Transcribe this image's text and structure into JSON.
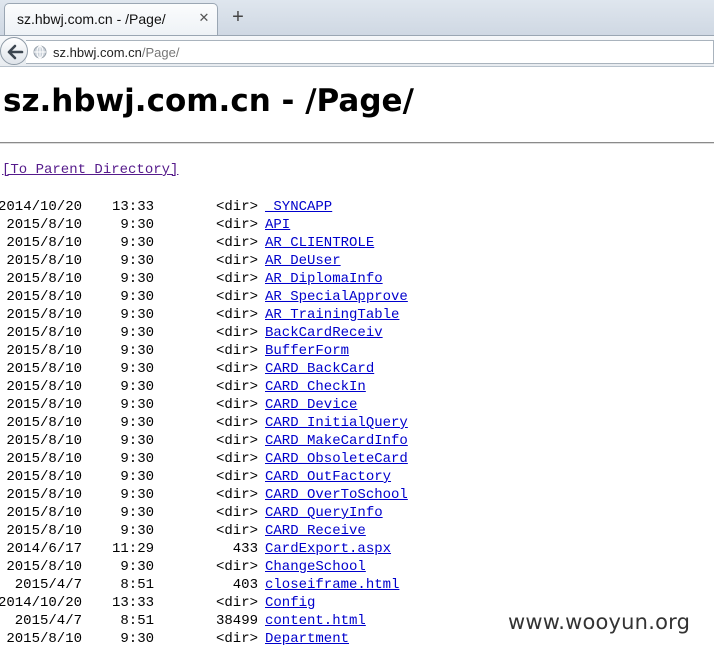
{
  "tab": {
    "title": "sz.hbwj.com.cn - /Page/",
    "close_glyph": "✕",
    "new_tab_glyph": "+"
  },
  "address_bar": {
    "host": "sz.hbwj.com.cn",
    "path": "/Page/"
  },
  "page": {
    "heading": "sz.hbwj.com.cn - /Page/",
    "parent_link": "[To Parent Directory]"
  },
  "listing": [
    {
      "date": "2014/10/20",
      "time": "13:33",
      "size": "<dir>",
      "name": "_SYNCAPP"
    },
    {
      "date": "2015/8/10",
      "time": "9:30",
      "size": "<dir>",
      "name": "API"
    },
    {
      "date": "2015/8/10",
      "time": "9:30",
      "size": "<dir>",
      "name": "AR_CLIENTROLE"
    },
    {
      "date": "2015/8/10",
      "time": "9:30",
      "size": "<dir>",
      "name": "AR_DeUser"
    },
    {
      "date": "2015/8/10",
      "time": "9:30",
      "size": "<dir>",
      "name": "AR_DiplomaInfo"
    },
    {
      "date": "2015/8/10",
      "time": "9:30",
      "size": "<dir>",
      "name": "AR_SpecialApprove"
    },
    {
      "date": "2015/8/10",
      "time": "9:30",
      "size": "<dir>",
      "name": "AR_TrainingTable"
    },
    {
      "date": "2015/8/10",
      "time": "9:30",
      "size": "<dir>",
      "name": "BackCardReceiv"
    },
    {
      "date": "2015/8/10",
      "time": "9:30",
      "size": "<dir>",
      "name": "BufferForm"
    },
    {
      "date": "2015/8/10",
      "time": "9:30",
      "size": "<dir>",
      "name": "CARD_BackCard"
    },
    {
      "date": "2015/8/10",
      "time": "9:30",
      "size": "<dir>",
      "name": "CARD_CheckIn"
    },
    {
      "date": "2015/8/10",
      "time": "9:30",
      "size": "<dir>",
      "name": "CARD_Device"
    },
    {
      "date": "2015/8/10",
      "time": "9:30",
      "size": "<dir>",
      "name": "CARD_InitialQuery"
    },
    {
      "date": "2015/8/10",
      "time": "9:30",
      "size": "<dir>",
      "name": "CARD_MakeCardInfo"
    },
    {
      "date": "2015/8/10",
      "time": "9:30",
      "size": "<dir>",
      "name": "CARD_ObsoleteCard"
    },
    {
      "date": "2015/8/10",
      "time": "9:30",
      "size": "<dir>",
      "name": "CARD_OutFactory"
    },
    {
      "date": "2015/8/10",
      "time": "9:30",
      "size": "<dir>",
      "name": "CARD_OverToSchool"
    },
    {
      "date": "2015/8/10",
      "time": "9:30",
      "size": "<dir>",
      "name": "CARD_QueryInfo"
    },
    {
      "date": "2015/8/10",
      "time": "9:30",
      "size": "<dir>",
      "name": "CARD_Receive"
    },
    {
      "date": "2014/6/17",
      "time": "11:29",
      "size": "433",
      "name": "CardExport.aspx"
    },
    {
      "date": "2015/8/10",
      "time": "9:30",
      "size": "<dir>",
      "name": "ChangeSchool"
    },
    {
      "date": "2015/4/7",
      "time": "8:51",
      "size": "403",
      "name": "closeiframe.html"
    },
    {
      "date": "2014/10/20",
      "time": "13:33",
      "size": "<dir>",
      "name": "Config"
    },
    {
      "date": "2015/4/7",
      "time": "8:51",
      "size": "38499",
      "name": "content.html"
    },
    {
      "date": "2015/8/10",
      "time": "9:30",
      "size": "<dir>",
      "name": "Department"
    }
  ],
  "watermark": "www.wooyun.org",
  "colors": {
    "link": "#0000cc",
    "visited_link": "#551a8b",
    "tabstrip": "#cfd8e3"
  }
}
